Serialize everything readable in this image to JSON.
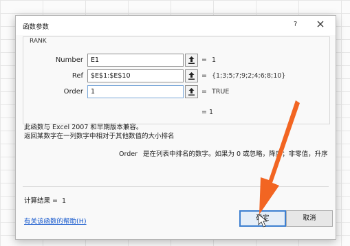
{
  "dialog": {
    "title": "函数参数",
    "help_glyph": "?",
    "close_glyph": "close"
  },
  "function": {
    "name": "RANK",
    "args": [
      {
        "label": "Number",
        "value": "E1",
        "result": "1"
      },
      {
        "label": "Ref",
        "value": "$E$1:$E$10",
        "result": "{1;3;5;7;9;2;4;6;8;10}"
      },
      {
        "label": "Order",
        "value": "1",
        "result": "TRUE"
      }
    ],
    "equals": "=",
    "formula_result_line": "1",
    "description_line1": "此函数与 Excel 2007 和早期版本兼容。",
    "description_line2": "返回某数字在一列数字中相对于其他数值的大小排名",
    "param_name": "Order",
    "param_desc": "是在列表中排名的数字。如果为 0 或忽略，降序；非零值，升序"
  },
  "footer": {
    "calc_label": "计算结果 =",
    "calc_value": "1",
    "help_link": "有关该函数的帮助(H)",
    "ok_label": "确定",
    "cancel_label": "取消"
  },
  "colors": {
    "accent": "#3c7fd0",
    "annotation_arrow": "#f26522",
    "link": "#1155cc"
  },
  "icons": {
    "ref_button": "collapse-dialog-arrow-icon",
    "close": "close-icon",
    "pointer": "mouse-cursor-icon"
  }
}
